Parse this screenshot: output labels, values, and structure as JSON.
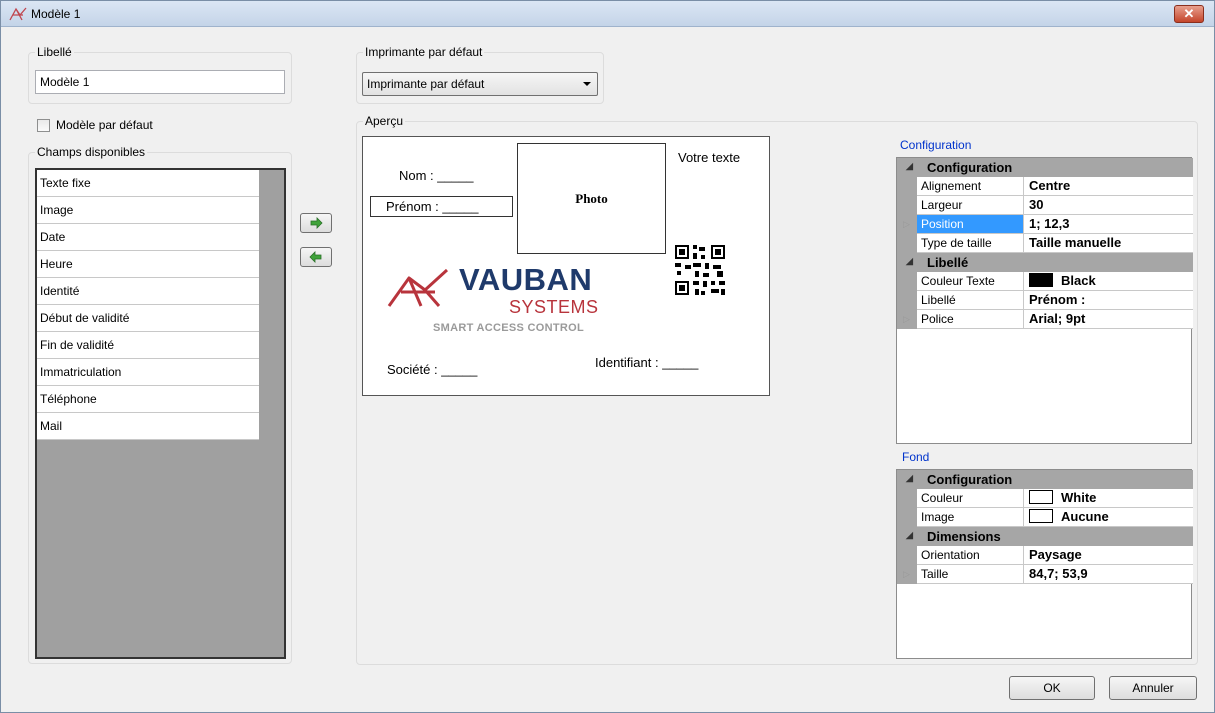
{
  "window": {
    "title": "Modèle 1",
    "close_label": "✕"
  },
  "libelle": {
    "group_title": "Libellé",
    "value": "Modèle 1"
  },
  "printer": {
    "group_title": "Imprimante par défaut",
    "selected": "Imprimante par défaut"
  },
  "default_model": {
    "label": "Modèle par défaut",
    "checked": false
  },
  "fields": {
    "group_title": "Champs disponibles",
    "items": [
      "Texte fixe",
      "Image",
      "Date",
      "Heure",
      "Identité",
      "Début de validité",
      "Fin de validité",
      "Immatriculation",
      "Téléphone",
      "Mail"
    ]
  },
  "preview": {
    "group_title": "Aperçu",
    "nom": "Nom : _____",
    "prenom": "Prénom : _____",
    "photo": "Photo",
    "votre_texte": "Votre texte",
    "logo_line1": "VAUBAN",
    "logo_line2": "SYSTEMS",
    "logo_line3": "SMART ACCESS CONTROL",
    "societe": "Société : _____",
    "identifiant": "Identifiant : _____",
    "colors": {
      "brand_red": "#b8343c",
      "brand_navy": "#1f3a6b",
      "brand_gray": "#9a9a9a"
    }
  },
  "configuration": {
    "label": "Configuration",
    "categories": [
      {
        "name": "Configuration",
        "rows": [
          {
            "name": "Alignement",
            "value": "Centre"
          },
          {
            "name": "Largeur",
            "value": "30"
          },
          {
            "name": "Position",
            "value": "1; 12,3",
            "selected": true,
            "expandable": true
          },
          {
            "name": "Type de taille",
            "value": "Taille manuelle"
          }
        ]
      },
      {
        "name": "Libellé",
        "rows": [
          {
            "name": "Couleur Texte",
            "value": "Black",
            "swatch": "#000000"
          },
          {
            "name": "Libellé",
            "value": "Prénom :"
          },
          {
            "name": "Police",
            "value": "Arial; 9pt",
            "expandable": true
          }
        ]
      }
    ]
  },
  "fond": {
    "label": "Fond",
    "categories": [
      {
        "name": "Configuration",
        "rows": [
          {
            "name": "Couleur",
            "value": "White",
            "swatch": "#ffffff"
          },
          {
            "name": "Image",
            "value": "Aucune",
            "swatch": "#ffffff"
          }
        ]
      },
      {
        "name": "Dimensions",
        "rows": [
          {
            "name": "Orientation",
            "value": "Paysage"
          },
          {
            "name": "Taille",
            "value": "84,7; 53,9",
            "expandable": true
          }
        ]
      }
    ]
  },
  "buttons": {
    "ok": "OK",
    "cancel": "Annuler"
  }
}
